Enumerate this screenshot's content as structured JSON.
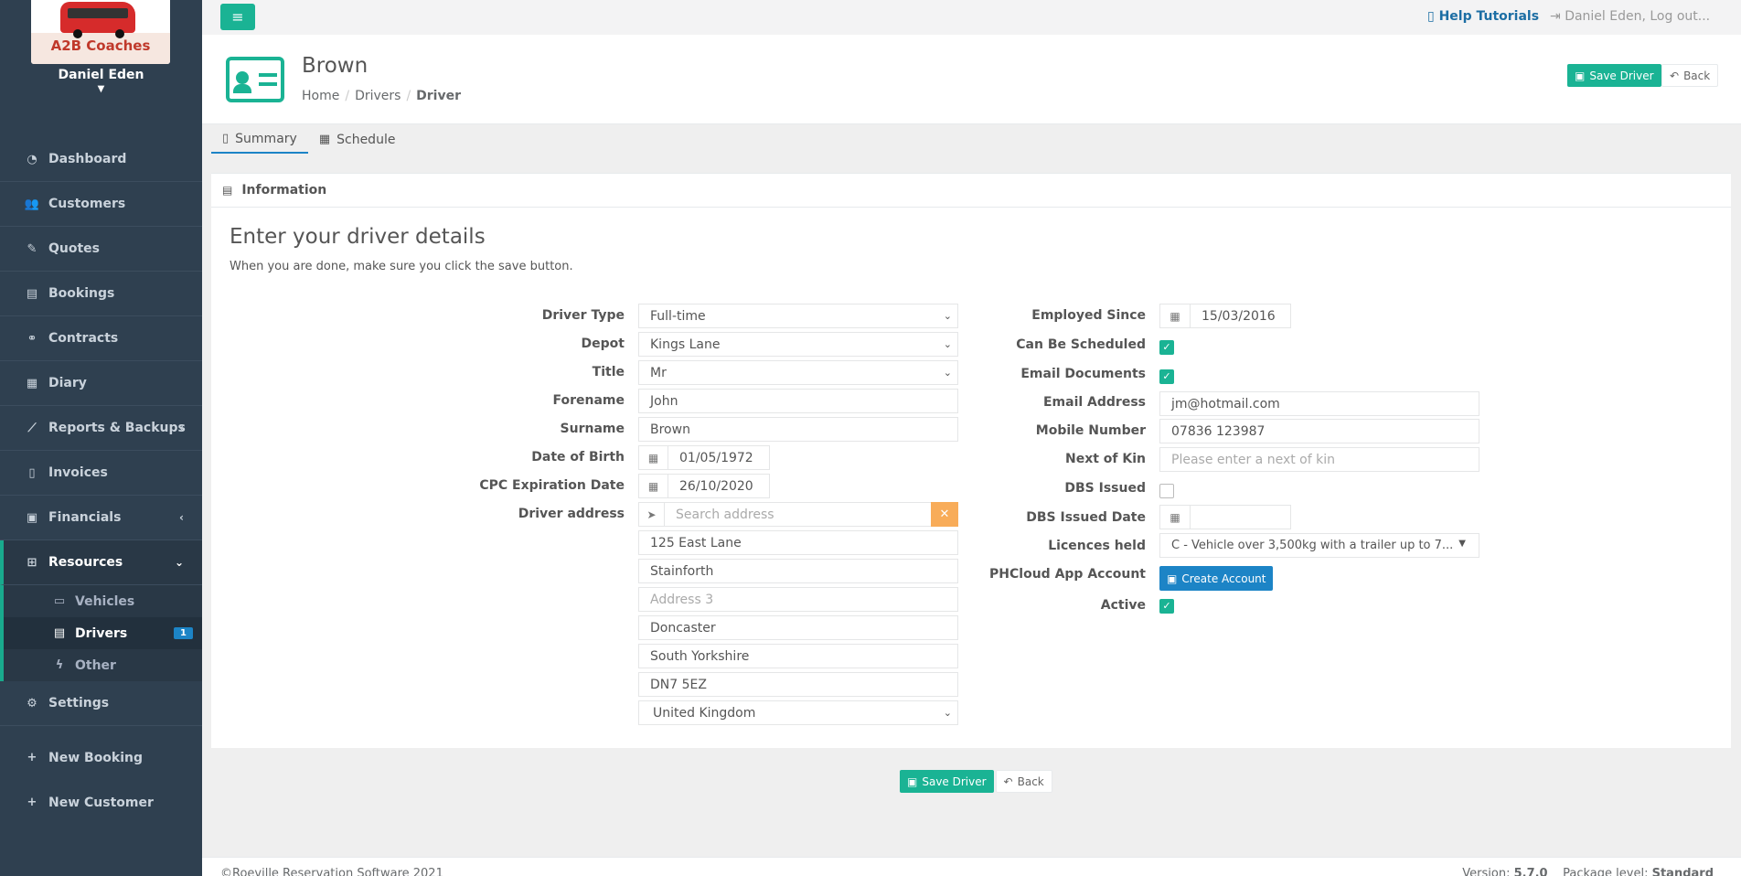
{
  "sidebar": {
    "logo_text": "A2B Coaches",
    "user_name": "Daniel Eden",
    "items": [
      {
        "label": "Dashboard",
        "icon": "dashboard-icon"
      },
      {
        "label": "Customers",
        "icon": "users-icon"
      },
      {
        "label": "Quotes",
        "icon": "pencil-icon"
      },
      {
        "label": "Bookings",
        "icon": "book-icon"
      },
      {
        "label": "Contracts",
        "icon": "handshake-icon"
      },
      {
        "label": "Diary",
        "icon": "calendar-icon"
      },
      {
        "label": "Reports & Backups",
        "icon": "chart-icon"
      },
      {
        "label": "Invoices",
        "icon": "file-icon"
      },
      {
        "label": "Financials",
        "icon": "money-icon"
      },
      {
        "label": "Resources",
        "icon": "sitemap-icon"
      }
    ],
    "resources_sub": [
      {
        "label": "Vehicles",
        "icon": "bus-icon"
      },
      {
        "label": "Drivers",
        "icon": "id-card-icon",
        "badge": "1"
      },
      {
        "label": "Other",
        "icon": "bolt-icon"
      }
    ],
    "settings": "Settings",
    "new_booking": "New Booking",
    "new_customer": "New Customer"
  },
  "topbar": {
    "help": "Help Tutorials",
    "logout": "Daniel Eden, Log out..."
  },
  "header": {
    "title": "Brown",
    "breadcrumb": [
      "Home",
      "Drivers",
      "Driver"
    ],
    "save_label": "Save Driver",
    "back_label": "Back"
  },
  "tabs": [
    "Summary",
    "Schedule"
  ],
  "panel": {
    "title": "Information",
    "heading": "Enter your driver details",
    "subheading": "When you are done, make sure you click the save button."
  },
  "form_left": {
    "driver_type": {
      "label": "Driver Type",
      "value": "Full-time"
    },
    "depot": {
      "label": "Depot",
      "value": "Kings Lane"
    },
    "title": {
      "label": "Title",
      "value": "Mr"
    },
    "forename": {
      "label": "Forename",
      "value": "John"
    },
    "surname": {
      "label": "Surname",
      "value": "Brown"
    },
    "dob": {
      "label": "Date of Birth",
      "value": "01/05/1972"
    },
    "cpc": {
      "label": "CPC Expiration Date",
      "value": "26/10/2020"
    },
    "address": {
      "label": "Driver address",
      "search_placeholder": "Search address",
      "line1": "125 East Lane",
      "line2": "Stainforth",
      "line3_placeholder": "Address 3",
      "city": "Doncaster",
      "county": "South Yorkshire",
      "postcode": "DN7 5EZ",
      "country": "United Kingdom"
    }
  },
  "form_right": {
    "employed_since": {
      "label": "Employed Since",
      "value": "15/03/2016"
    },
    "can_be_scheduled": {
      "label": "Can Be Scheduled",
      "checked": true
    },
    "email_documents": {
      "label": "Email Documents",
      "checked": true
    },
    "email": {
      "label": "Email Address",
      "value": "jm@hotmail.com"
    },
    "mobile": {
      "label": "Mobile Number",
      "value": "07836 123987"
    },
    "next_of_kin": {
      "label": "Next of Kin",
      "placeholder": "Please enter a next of kin"
    },
    "dbs_issued": {
      "label": "DBS Issued",
      "checked": false
    },
    "dbs_date": {
      "label": "DBS Issued Date",
      "value": ""
    },
    "licences": {
      "label": "Licences held",
      "value": "C - Vehicle over 3,500kg with a trailer up to 7..."
    },
    "app_account": {
      "label": "PHCloud App Account",
      "button": "Create Account"
    },
    "active": {
      "label": "Active",
      "checked": true
    }
  },
  "footer": {
    "copyright": "©Roeville Reservation Software 2021",
    "version_label": "Version:",
    "version": "5.7.0",
    "package_label": "Package level:",
    "package": "Standard"
  },
  "colors": {
    "accent": "#1ab394",
    "sidebar": "#2f4050",
    "link": "#1c84c6",
    "warning": "#f8ac59"
  }
}
